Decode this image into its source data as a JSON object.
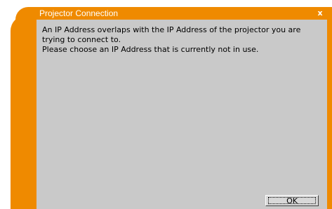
{
  "window": {
    "title": "Projector Connection",
    "close_label": "x"
  },
  "message": {
    "lines": [
      "An IP Address overlaps with the IP Address of the projector you are trying to connect to.",
      "Please choose an IP Address that is currently not in use."
    ]
  },
  "buttons": {
    "ok_label": "OK"
  },
  "colors": {
    "frame": "#ef8a00",
    "content_background": "#c9c9c9",
    "title_text": "#ffffff"
  }
}
